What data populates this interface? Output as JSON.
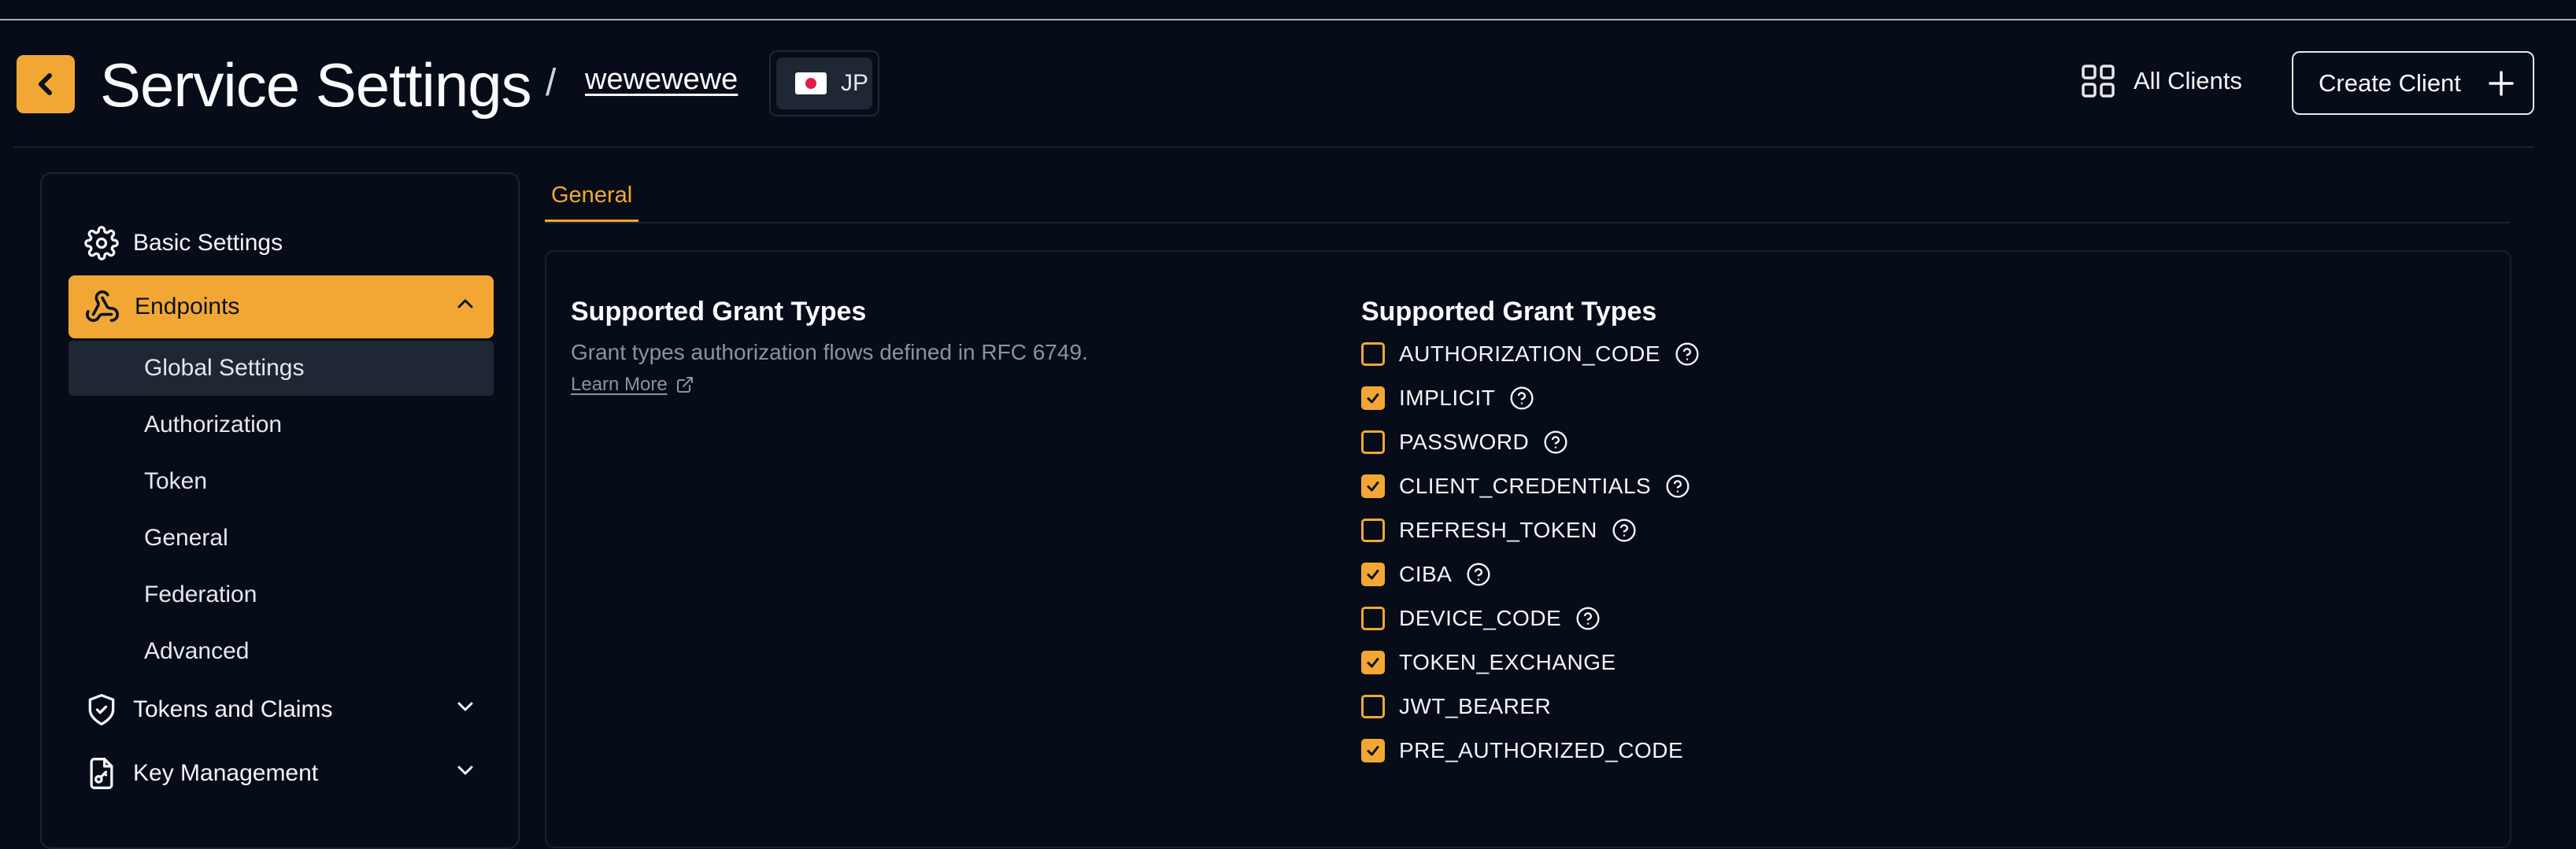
{
  "header": {
    "title": "Service Settings",
    "separator": "/",
    "breadcrumb": "wewewewe",
    "language": "JP",
    "all_clients_label": "All Clients",
    "create_client_label": "Create Client"
  },
  "sidebar": {
    "items": [
      {
        "label": "Basic Settings",
        "icon": "gear-icon"
      },
      {
        "label": "Endpoints",
        "icon": "webhook-icon",
        "expanded": true,
        "active": true
      },
      {
        "label": "Tokens and Claims",
        "icon": "shield-check-icon",
        "expanded": false
      },
      {
        "label": "Key Management",
        "icon": "file-key-icon",
        "expanded": false
      }
    ],
    "endpoint_subitems": [
      "Global Settings",
      "Authorization",
      "Token",
      "General",
      "Federation",
      "Advanced"
    ],
    "selected_subitem": "Global Settings"
  },
  "tabs": [
    {
      "label": "General",
      "active": true
    }
  ],
  "section": {
    "title": "Supported Grant Types",
    "description": "Grant types authorization flows defined in RFC 6749.",
    "learn_more": "Learn More"
  },
  "grant_list": {
    "title": "Supported Grant Types",
    "items": [
      {
        "label": "AUTHORIZATION_CODE",
        "checked": false,
        "help": true
      },
      {
        "label": "IMPLICIT",
        "checked": true,
        "help": true
      },
      {
        "label": "PASSWORD",
        "checked": false,
        "help": true
      },
      {
        "label": "CLIENT_CREDENTIALS",
        "checked": true,
        "help": true
      },
      {
        "label": "REFRESH_TOKEN",
        "checked": false,
        "help": true
      },
      {
        "label": "CIBA",
        "checked": true,
        "help": true
      },
      {
        "label": "DEVICE_CODE",
        "checked": false,
        "help": true
      },
      {
        "label": "TOKEN_EXCHANGE",
        "checked": true,
        "help": false
      },
      {
        "label": "JWT_BEARER",
        "checked": false,
        "help": false
      },
      {
        "label": "PRE_AUTHORIZED_CODE",
        "checked": true,
        "help": false
      }
    ]
  },
  "colors": {
    "accent": "#f2a735",
    "background": "#070d18",
    "panel": "#1f2634"
  }
}
